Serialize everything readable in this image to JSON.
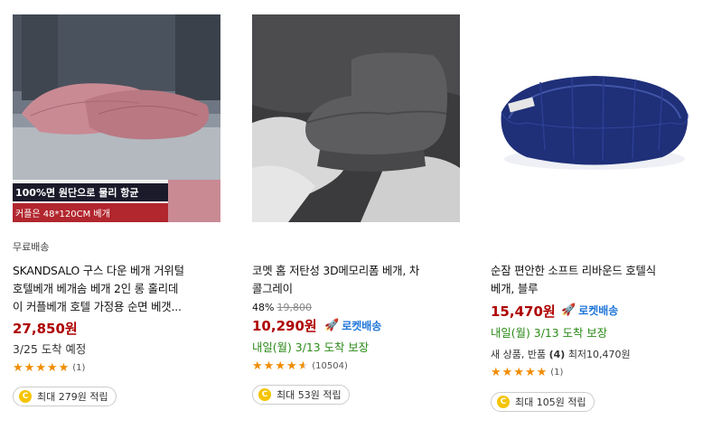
{
  "products": [
    {
      "badge": "무료배송",
      "image_banner_line1": "100%면 원단으로 물리 항균",
      "image_banner_line2": "커플은 48*120CM 베개",
      "name_line1": "SKANDSALO 구스 다운 베개 거위털",
      "name_line2": "호텔베개 베개솜 베개 2인 롱 홀리데",
      "name_line3": "이 커플베개 호텔 가정용 순면 베갯...",
      "price": "27,850원",
      "delivery": "3/25 도착 예정",
      "rating": 5,
      "review_count": "(1)",
      "cashback": "최대 279원 적립"
    },
    {
      "name_line1": "코멧 홈 저탄성 3D메모리폼 베개, 차",
      "name_line2": "콜그레이",
      "discount": "48%",
      "original_price": "19,800",
      "price": "10,290원",
      "rocket": "로켓배송",
      "delivery": "내일(월) 3/13 도착 보장",
      "rating": 4.5,
      "review_count": "(10504)",
      "cashback": "최대 53원 적립"
    },
    {
      "name_line1": "순잠 편안한 소프트 리바운드 호텔식",
      "name_line2": "베개, 블루",
      "price": "15,470원",
      "rocket": "로켓배송",
      "delivery": "내일(월) 3/13 도착 보장",
      "extra_prefix": "새 상품, 반품",
      "extra_count": "(4)",
      "extra_suffix": "최저10,470원",
      "rating": 5,
      "review_count": "(1)",
      "cashback": "최대 105원 적립"
    }
  ],
  "colors": {
    "price": "#ae0000",
    "rocket": "#1f75d8",
    "delivery_guarantee": "#2c8a19",
    "star": "#f08c00"
  },
  "icons": [
    "rocket-icon",
    "coin-icon",
    "star-icon"
  ]
}
